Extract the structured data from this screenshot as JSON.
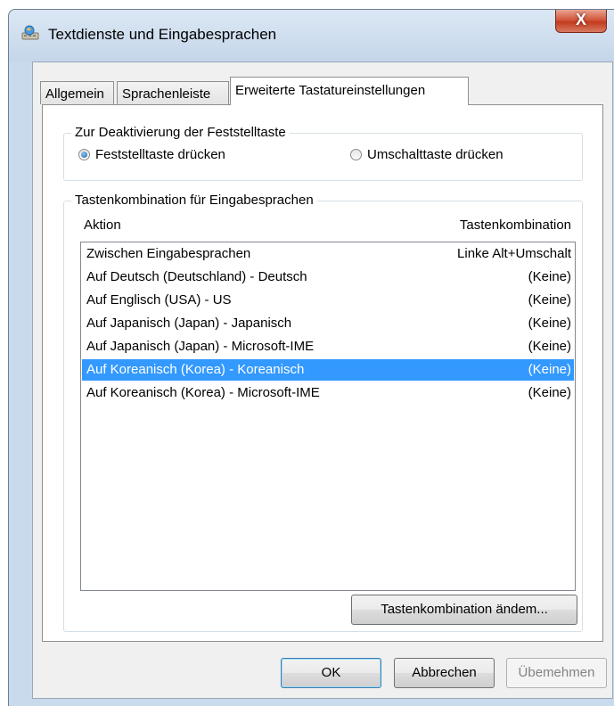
{
  "window": {
    "title": "Textdienste und Eingabesprachen",
    "close_label": "X"
  },
  "tabs": [
    {
      "label": "Allgemein",
      "active": false
    },
    {
      "label": "Sprachenleiste",
      "active": false
    },
    {
      "label": "Erweiterte Tastatureinstellungen",
      "active": true
    }
  ],
  "capslock_group": {
    "title": "Zur Deaktivierung der Feststelltaste",
    "options": [
      {
        "label": "Feststelltaste drücken",
        "checked": true
      },
      {
        "label": "Umschalttaste drücken",
        "checked": false
      }
    ]
  },
  "hotkeys_group": {
    "title": "Tastenkombination für Eingabesprachen",
    "columns": {
      "action": "Aktion",
      "combination": "Tastenkombination"
    },
    "rows": [
      {
        "action": "Zwischen Eingabesprachen",
        "combination": "Linke Alt+Umschalt",
        "selected": false
      },
      {
        "action": "Auf Deutsch (Deutschland) - Deutsch",
        "combination": "(Keine)",
        "selected": false
      },
      {
        "action": "Auf Englisch (USA) - US",
        "combination": "(Keine)",
        "selected": false
      },
      {
        "action": "Auf Japanisch (Japan) - Japanisch",
        "combination": "(Keine)",
        "selected": false
      },
      {
        "action": "Auf Japanisch (Japan) - Microsoft-IME",
        "combination": "(Keine)",
        "selected": false
      },
      {
        "action": "Auf Koreanisch (Korea) - Koreanisch",
        "combination": "(Keine)",
        "selected": true
      },
      {
        "action": "Auf Koreanisch (Korea) - Microsoft-IME",
        "combination": "(Keine)",
        "selected": false
      }
    ],
    "change_button": "Tastenkombination ändem..."
  },
  "footer": {
    "ok": "OK",
    "cancel": "Abbrechen",
    "apply": "Übemehmen"
  },
  "colors": {
    "selection": "#3399ff",
    "close_button": "#c23b1f",
    "frame": "#c9daec"
  },
  "icons": {
    "app": "keyboard-globe-icon",
    "close": "close-icon"
  }
}
